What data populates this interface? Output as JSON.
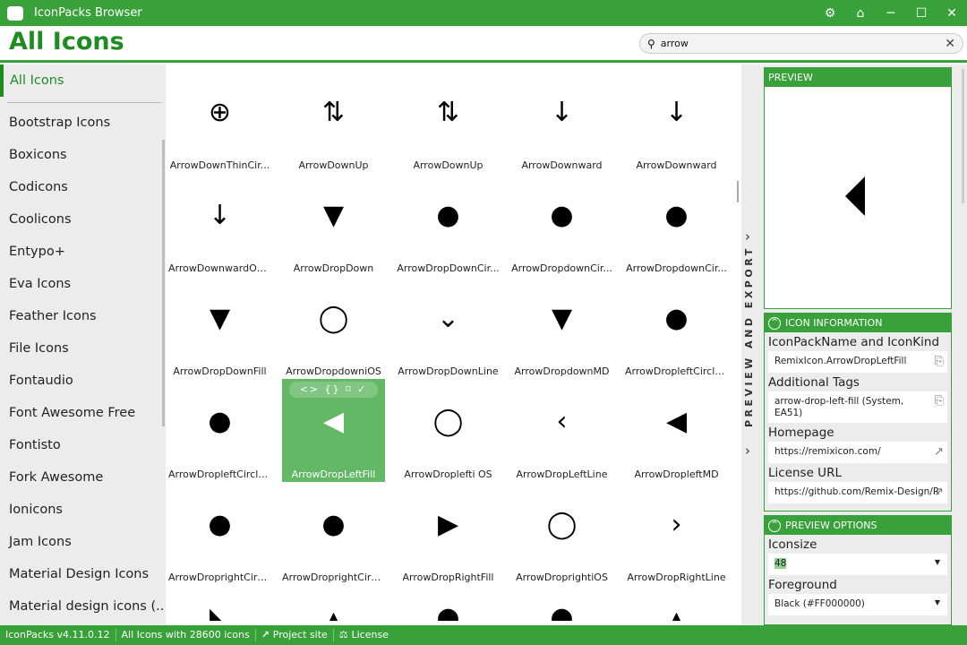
{
  "window": {
    "title": "IconPacks Browser",
    "buttons": [
      "⚙",
      "⌂",
      "─",
      "☐",
      "✕"
    ]
  },
  "header": {
    "title": "All Icons",
    "search_value": "arrow"
  },
  "sidebar": {
    "active": "All Icons",
    "items": [
      "Bootstrap Icons",
      "Boxicons",
      "Codicons",
      "Coolicons",
      "Entypo+",
      "Eva Icons",
      "Feather Icons",
      "File Icons",
      "Fontaudio",
      "Font Awesome Free",
      "Fontisto",
      "Fork Awesome",
      "Ionicons",
      "Jam Icons",
      "Material Design Icons",
      "Material design icons (..."
    ]
  },
  "grid": {
    "selected_index": 16,
    "hover_tools": "<> {} ⌑ ✓",
    "icons": [
      {
        "label": "ArrowDownThinCir...",
        "glyph": "⊕"
      },
      {
        "label": "ArrowDownUp",
        "glyph": "⇅"
      },
      {
        "label": "ArrowDownUp",
        "glyph": "⇅"
      },
      {
        "label": "ArrowDownward",
        "glyph": "↓"
      },
      {
        "label": "ArrowDownward",
        "glyph": "↓"
      },
      {
        "label": "ArrowDownwardOu...",
        "glyph": "↓"
      },
      {
        "label": "ArrowDropDown",
        "glyph": "▼"
      },
      {
        "label": "ArrowDropDownCir...",
        "glyph": "●"
      },
      {
        "label": "ArrowDropdownCir...",
        "glyph": "●"
      },
      {
        "label": "ArrowDropdownCir...",
        "glyph": "●"
      },
      {
        "label": "ArrowDropDownFill",
        "glyph": "▼"
      },
      {
        "label": "ArrowDropdowniOS",
        "glyph": "◯"
      },
      {
        "label": "ArrowDropDownLine",
        "glyph": "⌄"
      },
      {
        "label": "ArrowDropdownMD",
        "glyph": "▼"
      },
      {
        "label": "ArrowDropleftCircle...",
        "glyph": "●"
      },
      {
        "label": "ArrowDropleftCircle...",
        "glyph": "●"
      },
      {
        "label": "ArrowDropLeftFill",
        "glyph": "◀"
      },
      {
        "label": "ArrowDroplefti OS",
        "glyph": "◯"
      },
      {
        "label": "ArrowDropLeftLine",
        "glyph": "‹"
      },
      {
        "label": "ArrowDropleftMD",
        "glyph": "◀"
      },
      {
        "label": "ArrowDroprightCirc...",
        "glyph": "●"
      },
      {
        "label": "ArrowDroprightCirc...",
        "glyph": "●"
      },
      {
        "label": "ArrowDropRightFill",
        "glyph": "▶"
      },
      {
        "label": "ArrowDroprightiOS",
        "glyph": "◯"
      },
      {
        "label": "ArrowDropRightLine",
        "glyph": "›"
      },
      {
        "label": "",
        "glyph": "◣"
      },
      {
        "label": "",
        "glyph": "▴"
      },
      {
        "label": "",
        "glyph": "●"
      },
      {
        "label": "",
        "glyph": "●"
      },
      {
        "label": "",
        "glyph": "▴"
      }
    ]
  },
  "side_strip": {
    "label": "PREVIEW AND EXPORT"
  },
  "preview": {
    "title": "PREVIEW"
  },
  "icon_info": {
    "title": "ICON INFORMATION",
    "name_label": "IconPackName and IconKind",
    "name_value": "RemixIcon.ArrowDropLeftFill",
    "tags_label": "Additional Tags",
    "tags_value": "arrow-drop-left-fill (System, EA51)",
    "homepage_label": "Homepage",
    "homepage_value": "https://remixicon.com/",
    "license_label": "License URL",
    "license_value": "https://github.com/Remix-Design/R"
  },
  "preview_options": {
    "title": "PREVIEW OPTIONS",
    "iconsize_label": "Iconsize",
    "iconsize_value": "48",
    "foreground_label": "Foreground",
    "foreground_value": "Black (#FF000000)"
  },
  "statusbar": {
    "version": "IconPacks v4.11.0.12",
    "count": "All Icons with 28600 icons",
    "project": "Project site",
    "license": "License"
  },
  "colors": {
    "accent": "#38a13a",
    "title": "#1e8c21",
    "selected": "#63b865"
  }
}
